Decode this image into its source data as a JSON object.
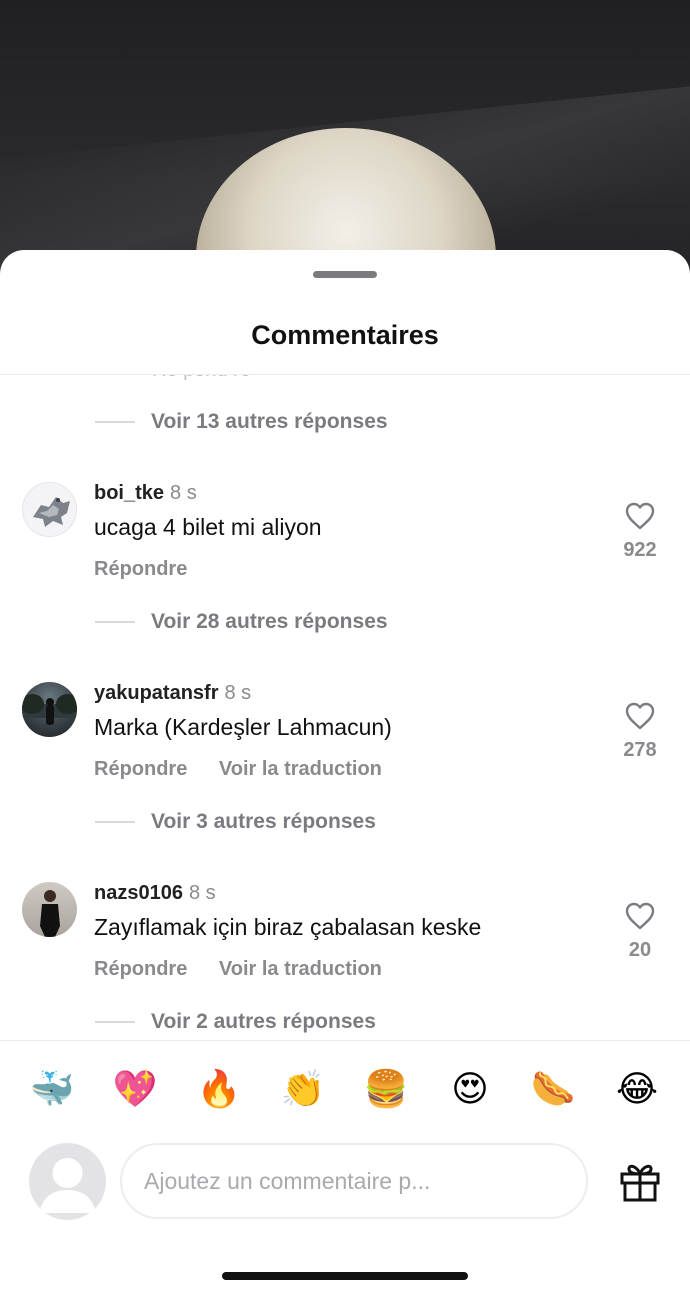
{
  "sheet": {
    "title": "Commentaires"
  },
  "top_replies": {
    "label": "Voir 13 autres réponses"
  },
  "comments": [
    {
      "username": "boi_tke",
      "time": "8 s",
      "text": "ucaga 4 bilet mi aliyon",
      "reply": "Répondre",
      "translate": "",
      "likes": "922",
      "more_replies": "Voir 28 autres réponses"
    },
    {
      "username": "yakupatansfr",
      "time": "8 s",
      "text": "Marka (Kardeşler Lahmacun)",
      "reply": "Répondre",
      "translate": "Voir la traduction",
      "likes": "278",
      "more_replies": "Voir 3 autres réponses"
    },
    {
      "username": "nazs0106",
      "time": "8 s",
      "text": "Zayıflamak için biraz çabalasan keske",
      "reply": "Répondre",
      "translate": "Voir la traduction",
      "likes": "20",
      "more_replies": "Voir 2 autres réponses"
    }
  ],
  "emojis": [
    "🐳",
    "💖",
    "🔥",
    "👏",
    "🍔",
    "😍",
    "🌭",
    "😂"
  ],
  "composer": {
    "placeholder": "Ajoutez un commentaire p..."
  },
  "icons": {
    "like": "heart-outline-icon",
    "gift": "gift-icon",
    "user": "default-avatar-icon"
  }
}
